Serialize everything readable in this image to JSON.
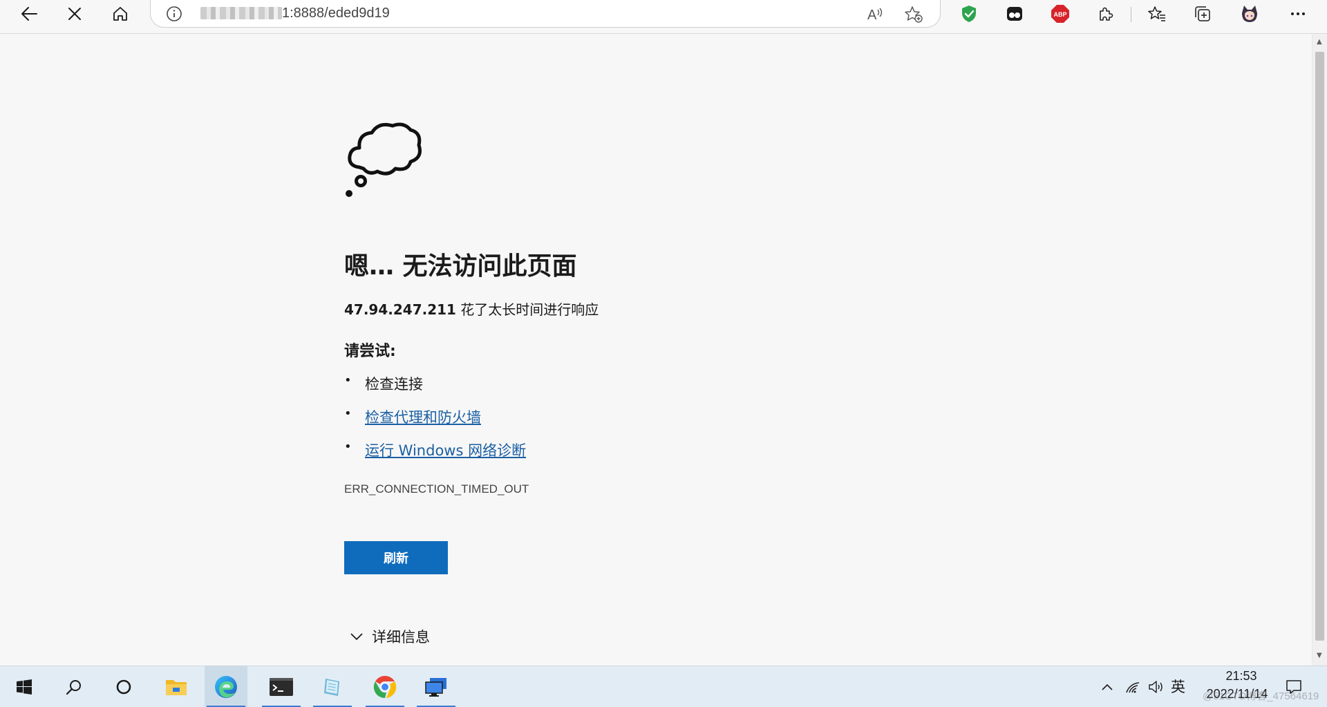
{
  "browser": {
    "address_suffix": "1:8888/eded9d19",
    "colors": {
      "accent": "#0f6cbd",
      "link": "#1a5fa3",
      "shield": "#2ea44f",
      "abp": "#d8232a"
    },
    "extensions": [
      "shield-extension-icon",
      "tampermonkey-extension-icon",
      "adblock-plus-icon",
      "extensions-puzzle-icon"
    ],
    "abp_label": "ABP"
  },
  "error_page": {
    "title": "嗯… 无法访问此页面",
    "host": "47.94.247.211",
    "description": " 花了太长时间进行响应",
    "try_label": "请尝试:",
    "suggestions": [
      {
        "text": "检查连接",
        "is_link": false
      },
      {
        "text": "检查代理和防火墙",
        "is_link": true
      },
      {
        "text": "运行 Windows 网络诊断",
        "is_link": true
      }
    ],
    "error_code": "ERR_CONNECTION_TIMED_OUT",
    "refresh_label": "刷新",
    "details_label": "详细信息"
  },
  "taskbar": {
    "apps": [
      "start",
      "search",
      "cortana",
      "file-explorer",
      "edge",
      "terminal",
      "notepad",
      "chrome",
      "remote-desktop"
    ],
    "ime_label": "英",
    "time": "21:53",
    "date": "2022/11/14",
    "watermark": "@51CTO博客_47564619"
  }
}
